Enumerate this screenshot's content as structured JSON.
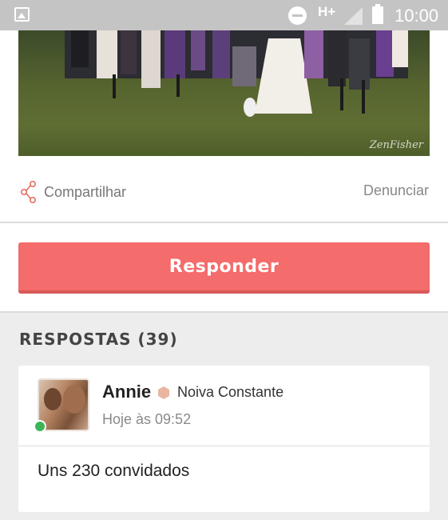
{
  "status_bar": {
    "network": "H+",
    "time": "10:00",
    "icons": [
      "gallery-icon",
      "do-not-disturb-icon",
      "signal-icon",
      "battery-icon"
    ]
  },
  "post": {
    "photo_watermark": "ZenFisher",
    "share_label": "Compartilhar",
    "report_label": "Denunciar"
  },
  "reply_button_label": "Responder",
  "answers": {
    "title": "RESPOSTAS (39)",
    "items": [
      {
        "author": "Annie",
        "badge": "Noiva Constante",
        "time": "Hoje às 09:52",
        "online": true,
        "text": "Uns 230 convidados"
      }
    ]
  },
  "colors": {
    "accent": "#f46c6b",
    "status_bar": "#c4c4c4",
    "online": "#3db45a",
    "badge": "#e9b4a0"
  }
}
